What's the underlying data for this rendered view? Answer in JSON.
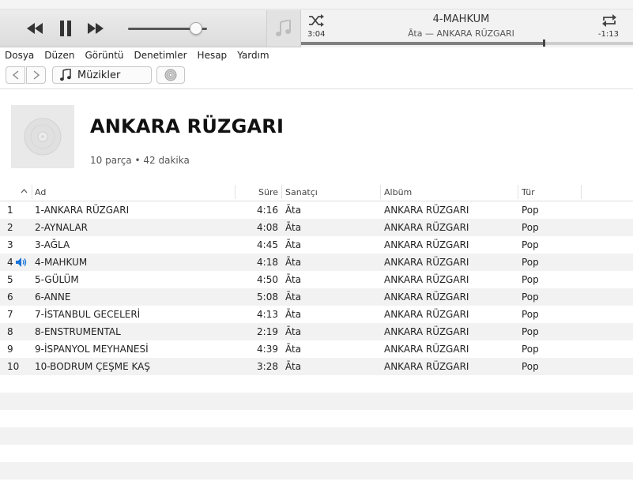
{
  "player": {
    "now_playing_title": "4-MAHKUM",
    "now_playing_subtitle": "Āta — ANKARA RÜZGARI",
    "elapsed": "3:04",
    "remaining": "-1:13",
    "progress_fraction": 0.73,
    "volume_fraction": 0.86
  },
  "menu": [
    "Dosya",
    "Düzen",
    "Görüntü",
    "Denetimler",
    "Hesap",
    "Yardım"
  ],
  "nav": {
    "media_label": "Müzikler"
  },
  "album": {
    "title": "ANKARA RÜZGARI",
    "meta": "10 parça • 42 dakika"
  },
  "table": {
    "headers": {
      "name": "Ad",
      "time": "Süre",
      "artist": "Sanatçı",
      "album": "Albüm",
      "genre": "Tür"
    },
    "playing_index": 3,
    "rows": [
      {
        "num": "1",
        "name": "1-ANKARA RÜZGARI",
        "time": "4:16",
        "artist": "Āta",
        "album": "ANKARA RÜZGARI",
        "genre": "Pop"
      },
      {
        "num": "2",
        "name": "2-AYNALAR",
        "time": "4:08",
        "artist": "Āta",
        "album": "ANKARA RÜZGARI",
        "genre": "Pop"
      },
      {
        "num": "3",
        "name": "3-AĞLA",
        "time": "4:45",
        "artist": "Āta",
        "album": "ANKARA RÜZGARI",
        "genre": "Pop"
      },
      {
        "num": "4",
        "name": "4-MAHKUM",
        "time": "4:18",
        "artist": "Āta",
        "album": "ANKARA RÜZGARI",
        "genre": "Pop"
      },
      {
        "num": "5",
        "name": "5-GÜLÜM",
        "time": "4:50",
        "artist": "Āta",
        "album": "ANKARA RÜZGARI",
        "genre": "Pop"
      },
      {
        "num": "6",
        "name": "6-ANNE",
        "time": "5:08",
        "artist": "Āta",
        "album": "ANKARA RÜZGARI",
        "genre": "Pop"
      },
      {
        "num": "7",
        "name": "7-İSTANBUL GECELERİ",
        "time": "4:13",
        "artist": "Āta",
        "album": "ANKARA RÜZGARI",
        "genre": "Pop"
      },
      {
        "num": "8",
        "name": "8-ENSTRUMENTAL",
        "time": "2:19",
        "artist": "Āta",
        "album": "ANKARA RÜZGARI",
        "genre": "Pop"
      },
      {
        "num": "9",
        "name": "9-İSPANYOL MEYHANESİ",
        "time": "4:39",
        "artist": "Āta",
        "album": "ANKARA RÜZGARI",
        "genre": "Pop"
      },
      {
        "num": "10",
        "name": "10-BODRUM ÇEŞME KAŞ",
        "time": "3:28",
        "artist": "Āta",
        "album": "ANKARA RÜZGARI",
        "genre": "Pop"
      }
    ]
  },
  "colors": {
    "accent": "#1a73d9",
    "row_alt": "#f2f2f2"
  }
}
